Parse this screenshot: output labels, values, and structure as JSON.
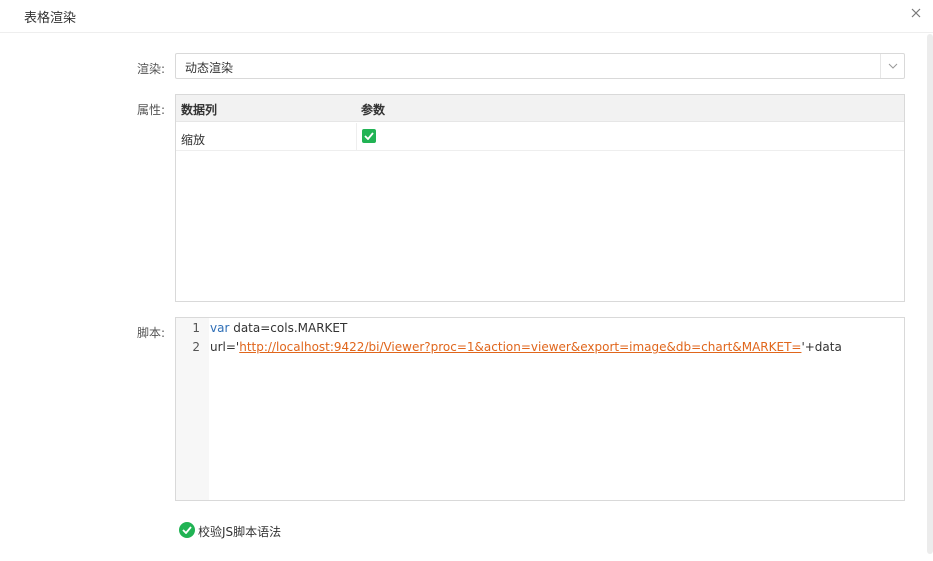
{
  "dialog": {
    "title": "表格渲染",
    "close_icon": "close-icon"
  },
  "render": {
    "label": "渲染:",
    "value": "动态渲染"
  },
  "properties": {
    "label": "属性:",
    "columns": [
      "数据列",
      "参数"
    ],
    "rows": [
      {
        "name": "缩放",
        "checked": true
      }
    ],
    "check_color": "#21b354"
  },
  "script": {
    "label": "脚本:",
    "lines": [
      {
        "num": "1",
        "keyword": "var",
        "rest": " data=cols.MARKET"
      },
      {
        "num": "2",
        "prefix": "url='",
        "url": "http://localhost:9422/bi/Viewer?proc=1&action=viewer&export=image&db=chart&MARKET=",
        "suffix": "'+data"
      }
    ]
  },
  "validate": {
    "label": "校验JS脚本语法",
    "icon": "check-circle-icon"
  },
  "colors": {
    "accent": "#21b354",
    "keyword": "#2f6fb7",
    "string": "#e0661c"
  }
}
